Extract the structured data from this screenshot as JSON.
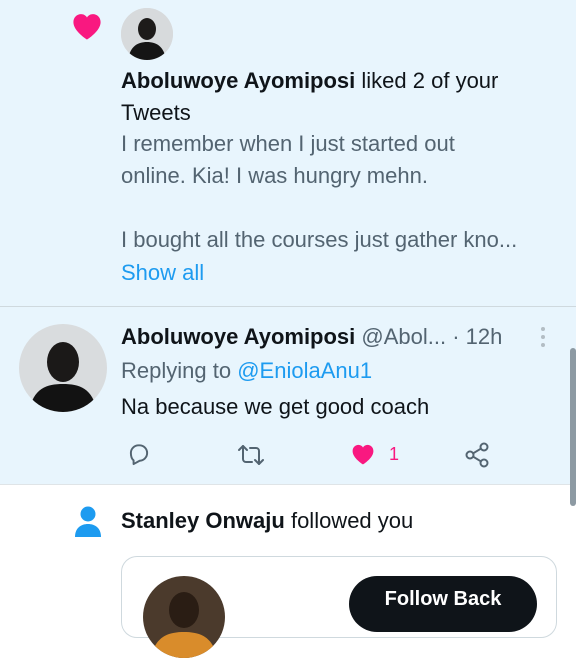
{
  "like_notification": {
    "user_name": "Aboluwoye Ayomiposi",
    "action_text": "liked 2 of your",
    "action_text_2": "Tweets",
    "tweet_line_1": "I remember when I just started out",
    "tweet_line_2": "online. Kia! I was hungry mehn.",
    "tweet_line_3": "I bought all the courses just gather kno...",
    "show_all": "Show all"
  },
  "reply": {
    "display_name": "Aboluwoye Ayomiposi",
    "handle": "@Abol...",
    "time": "· 12h",
    "replying_prefix": "Replying to",
    "replying_handle": "@EniolaAnu1",
    "text": "Na because we get good coach",
    "like_count": "1"
  },
  "follow_notification": {
    "user_name": "Stanley Onwaju",
    "action_text": "followed you",
    "follow_back_label": "Follow Back"
  },
  "colors": {
    "accent": "#1d9bf0",
    "like": "#f91880",
    "highlight_bg": "#e8f5fd"
  }
}
